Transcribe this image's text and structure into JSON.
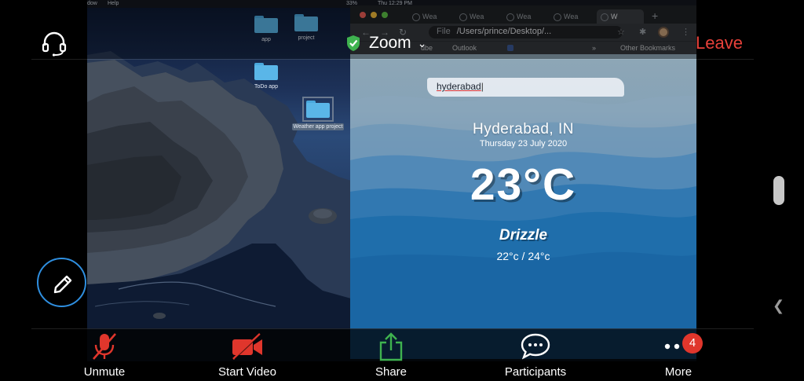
{
  "mac_menubar": {
    "items": [
      "dow",
      "Help"
    ],
    "battery": "33%",
    "clock": "Thu 12:29 PM"
  },
  "desktop": {
    "folders": [
      {
        "label": "app"
      },
      {
        "label": "project"
      },
      {
        "label": "ToDo app"
      },
      {
        "label": "Weather app project"
      }
    ]
  },
  "browser": {
    "tabs": [
      "Wea",
      "Wea",
      "Wea",
      "Wea",
      "W"
    ],
    "new_tab": "+",
    "omnibox": {
      "scheme": "File",
      "url": "/Users/prince/Desktop/..."
    },
    "bookmarks": [
      "ube",
      "Outlook",
      "»",
      "Other Bookmarks"
    ]
  },
  "weather": {
    "search_value": "hyderabad",
    "city": "Hyderabad, IN",
    "date": "Thursday 23 July 2020",
    "temperature": "23°C",
    "condition": "Drizzle",
    "range": "22°c / 24°c"
  },
  "zoom": {
    "title": "Zoom",
    "leave_label": "Leave",
    "controls": {
      "unmute": "Unmute",
      "start_video": "Start Video",
      "share": "Share",
      "participants": "Participants",
      "more": "More"
    },
    "more_badge": "4"
  },
  "colors": {
    "leave": "#e8413a",
    "badge": "#e0362c",
    "share_green": "#3fb34f",
    "muted_red": "#e0362c",
    "annotate_ring": "#2f8fe0",
    "shield_green": "#3fb34f"
  },
  "icons": {
    "audio": "headset-icon",
    "security": "shield-check-icon",
    "annotate": "pencil-icon",
    "unmute": "microphone-off-icon",
    "video": "video-camera-off-icon",
    "share": "share-upload-icon",
    "participants": "chat-bubble-icon",
    "more": "ellipsis-icon"
  }
}
